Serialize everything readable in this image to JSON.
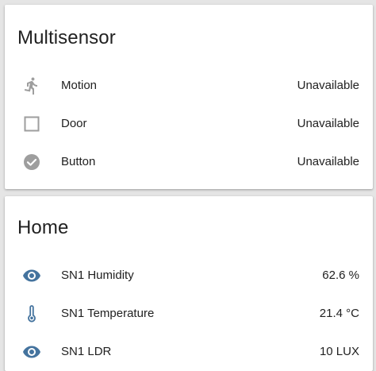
{
  "colors": {
    "background": "#e5e5e5",
    "card": "#ffffff",
    "icon_inactive": "#9e9e9e",
    "icon_active": "#44739e",
    "text": "#212121"
  },
  "multisensor": {
    "title": "Multisensor",
    "rows": [
      {
        "icon": "motion-walk-icon",
        "label": "Motion",
        "value": "Unavailable"
      },
      {
        "icon": "checkbox-blank-icon",
        "label": "Door",
        "value": "Unavailable"
      },
      {
        "icon": "check-circle-icon",
        "label": "Button",
        "value": "Unavailable"
      }
    ]
  },
  "home": {
    "title": "Home",
    "rows": [
      {
        "icon": "eye-icon",
        "label": "SN1 Humidity",
        "value": "62.6 %"
      },
      {
        "icon": "thermometer-icon",
        "label": "SN1 Temperature",
        "value": "21.4 °C"
      },
      {
        "icon": "eye-icon",
        "label": "SN1 LDR",
        "value": "10 LUX"
      }
    ]
  }
}
